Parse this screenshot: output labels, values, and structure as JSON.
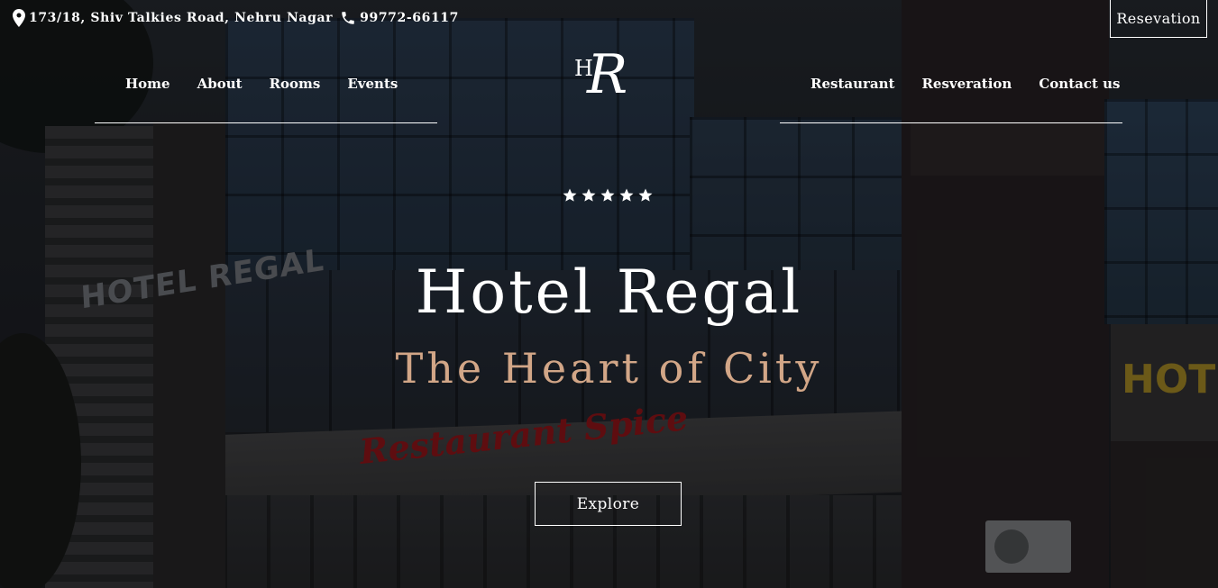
{
  "topbar": {
    "address_icon": "map-pin-icon",
    "address": "173/18, Shiv Talkies Road, Nehru Nagar",
    "phone_icon": "phone-icon",
    "phone": "99772-66117",
    "reservation_button": "Resevation"
  },
  "nav_left": [
    "Home",
    "About",
    "Rooms",
    "Events"
  ],
  "nav_right": [
    "Restaurant",
    "Resveration",
    "Contact us"
  ],
  "logo": {
    "h": "H",
    "r": "R"
  },
  "background_signs": {
    "hotel": "HOTEL REGAL",
    "restaurant": "Restaurant Spice",
    "hot": "HOT"
  },
  "hero": {
    "stars": 5,
    "title": "Hotel Regal",
    "subtitle": "The Heart of City",
    "button": "Explore"
  },
  "colors": {
    "subtitle": "#d2a687",
    "text": "#ffffff"
  }
}
